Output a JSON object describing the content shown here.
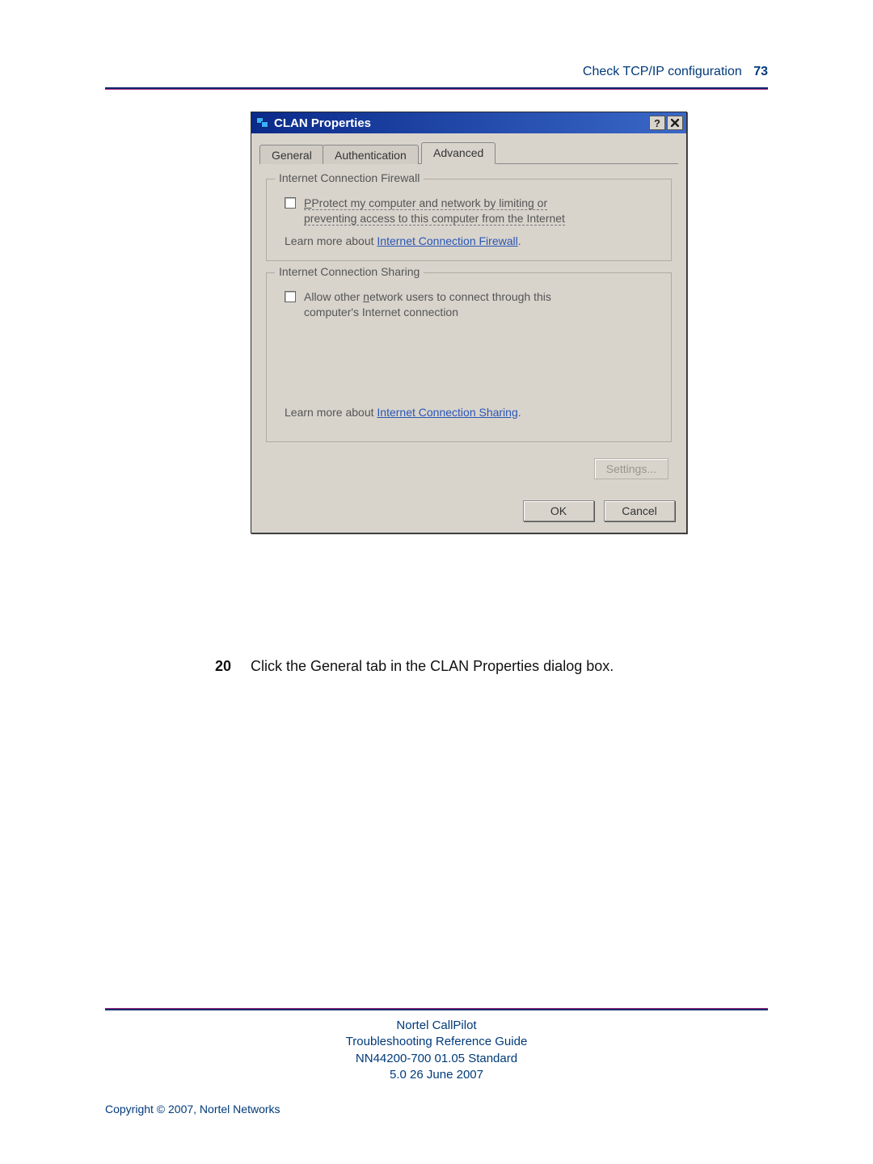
{
  "header": {
    "title": "Check TCP/IP configuration",
    "page_number": "73"
  },
  "dialog": {
    "title": "CLAN Properties",
    "help_glyph": "?",
    "tabs": {
      "general": "General",
      "auth": "Authentication",
      "advanced": "Advanced"
    },
    "firewall": {
      "legend": "Internet Connection Firewall",
      "checkbox_label_part1": "Protect my computer and network by limiting or ",
      "checkbox_label_part2": "preventing access to this computer from the Internet",
      "learn_prefix": "Learn more about ",
      "learn_link": "Internet Connection Firewall",
      "learn_suffix": "."
    },
    "sharing": {
      "legend": "Internet Connection Sharing",
      "checkbox_label_part1": "Allow other network users to connect through this",
      "checkbox_label_part2": "computer's Internet connection",
      "checkbox_underline_letter": "n",
      "learn_prefix": "Learn more about ",
      "learn_link": "Internet Connection Sharing",
      "learn_suffix": "."
    },
    "buttons": {
      "settings": "Settings...",
      "ok": "OK",
      "cancel": "Cancel"
    }
  },
  "step": {
    "number": "20",
    "text": "Click the General tab in the CLAN Properties dialog box."
  },
  "footer": {
    "line1": "Nortel CallPilot",
    "line2": "Troubleshooting Reference Guide",
    "line3": "NN44200-700   01.05   Standard",
    "line4": "5.0   26 June 2007"
  },
  "copyright": "Copyright © 2007, Nortel Networks"
}
